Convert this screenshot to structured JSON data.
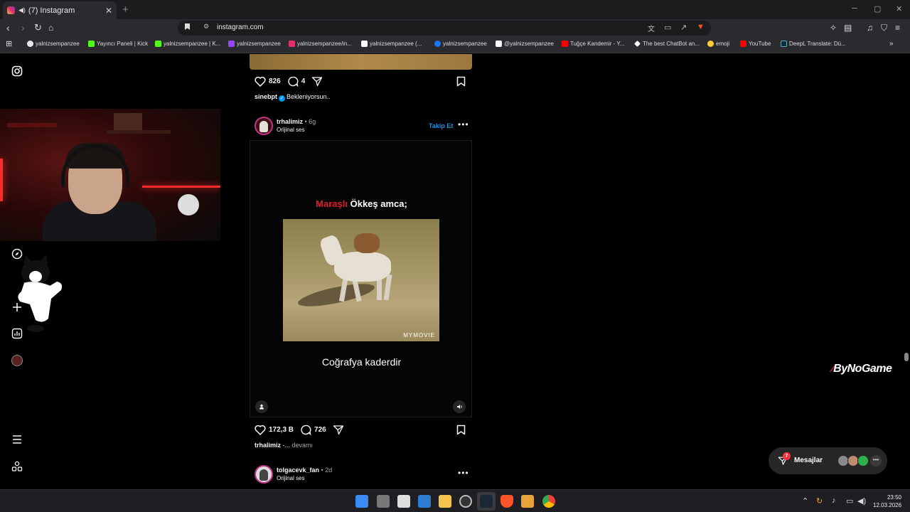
{
  "browser": {
    "tab_title": "(7) Instagram",
    "tab_close": "✕",
    "new_tab": "+",
    "url": "instagram.com",
    "bookmarks": [
      {
        "label": "yalnizsempanzee",
        "color": "#e8e8e8"
      },
      {
        "label": "Yayıncı Paneli | Kick",
        "color": "#53fc18"
      },
      {
        "label": "yalnizsempanzee | K...",
        "color": "#53fc18"
      },
      {
        "label": "yalnizsempanzee",
        "color": "#9146ff"
      },
      {
        "label": "yalnizsempanzee/in...",
        "color": "#e1306c"
      },
      {
        "label": "yalnizsempanzee (...",
        "color": "#ffffff"
      },
      {
        "label": "yalnizsempanzee",
        "color": "#1877f2"
      },
      {
        "label": "@yalnizsempanzee",
        "color": "#ffffff"
      },
      {
        "label": "Tuğçe Kandemir - Y...",
        "color": "#ff0000"
      },
      {
        "label": "The best ChatBot an...",
        "color": "#ffffff"
      },
      {
        "label": "emoji",
        "color": "#ffcc33"
      },
      {
        "label": "YouTube",
        "color": "#ff0000"
      },
      {
        "label": "DeepL Translate: Dü...",
        "color": "#0f2b46"
      }
    ]
  },
  "feed": {
    "post1": {
      "likes": "826",
      "comments": "4",
      "caption_user": "sinebpt",
      "caption_text": "Bekleniyorsun.."
    },
    "post2": {
      "username": "trhalimiz",
      "age": "• 6g",
      "audio": "Orijinal ses",
      "follow_label": "Takip Et",
      "more": "•••",
      "video_title_red": "Maraşlı",
      "video_title_rest": " Ökkeş amca;",
      "video_watermark": "MYMOVIE",
      "video_subtitle": "Coğrafya kaderdir",
      "likes": "172,3 B",
      "comments": "726",
      "caption_user": "trhalimiz",
      "caption_text": " -...",
      "caption_more": "devamı"
    },
    "post3": {
      "username": "tolgacevk_fan",
      "age": "• 2d",
      "audio": "Orijinal ses",
      "more": "•••"
    }
  },
  "overlay": {
    "logo": "ByNoGame"
  },
  "messages": {
    "label": "Mesajlar",
    "badge": "7",
    "more": "•••",
    "avatar_colors": [
      "#8a8a8a",
      "#c08a70",
      "#2fb24c"
    ]
  },
  "taskbar": {
    "time": "23:50",
    "date": "12.03.2026"
  }
}
